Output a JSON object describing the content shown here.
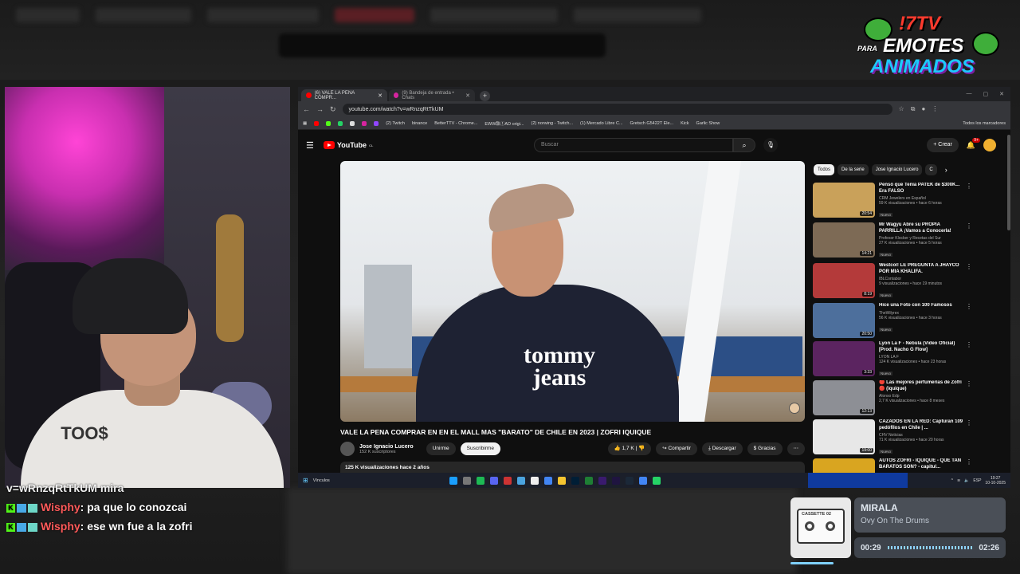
{
  "browser": {
    "tabs": [
      {
        "label": "(6) VALE LA PENA COMPR...",
        "active": true
      },
      {
        "label": "(9) Bandeja de entrada • Chats",
        "active": false
      }
    ],
    "url": "youtube.com/watch?v=wRnzqRtTkUM",
    "bookmarks": [
      "(2) Twitch",
      "binance",
      "BetterTTV - Chrome...",
      "EWW執①AD origi...",
      "(2) norwing - Twitch...",
      "(1) Mercado Libre C...",
      "Gretsch G5422T Ele...",
      "Kick",
      "Garlic Show"
    ],
    "all_bookmarks": "Todos los marcadores"
  },
  "youtube": {
    "logo": "YouTube",
    "logo_sup": "CL",
    "search_placeholder": "Buscar",
    "create_label": "Crear",
    "notif_count": "9+",
    "video": {
      "title": "VALE LA PENA COMPRAR EN EN EL MALL MAS \"BARATO\" DE CHILE EN 2023 | ZOFRI IQUIQUE",
      "channel": "Jose Ignacio Lucero",
      "subs": "152 K suscriptores",
      "join": "Unirme",
      "subscribe": "Suscribirme",
      "likes": "1,7 K",
      "share": "Compartir",
      "download": "Descargar",
      "thanks": "Gracias",
      "more": "⋯",
      "views_date": "125 K visualizaciones  hace 2 años"
    },
    "chips": [
      "Todos",
      "De la serie",
      "Jose Ignacio Lucero",
      "C"
    ],
    "recommendations": [
      {
        "title": "Pensó que Tenía PATEK de $300K... Era FALSO",
        "channel": "CRM Jewelers en Español",
        "meta": "59 K visualizaciones • hace 6 horas",
        "duration": "20:54",
        "badge": "Nuevo",
        "color": "#c9a15a"
      },
      {
        "title": "Mr Wagyu Abre su PROPIA PARRILLA ¡Vamos a Conocerla!",
        "channel": "Profesor Klocker y Recetas del Sur",
        "meta": "27 K visualizaciones • hace 5 horas",
        "duration": "14:21",
        "badge": "Nuevo",
        "color": "#7d6a55"
      },
      {
        "title": "Westcol! LE PREGUNTA A JHAYCO POR MIA KHALIFA.",
        "channel": "IBLContabor",
        "meta": "9 visualizaciones • hace 19 minutos",
        "duration": "8:19",
        "badge": "Nuevo",
        "color": "#b43a3a"
      },
      {
        "title": "Hice una Foto con 100 Famosos",
        "channel": "TheWilyrex",
        "meta": "56 K visualizaciones • hace 3 horas",
        "duration": "20:50",
        "badge": "Nuevo",
        "color": "#4d6f9c"
      },
      {
        "title": "Lyon La F - Nebula (Video Oficial) [Prod. Nacho G Flow]",
        "channel": "LYON LA F",
        "meta": "124 K visualizaciones • hace 23 horas",
        "duration": "3:33",
        "badge": "Nuevo",
        "color": "#5b2460"
      },
      {
        "title": "🔴 Las mejores perfumerías de Zofri 🔴 (iquique)",
        "channel": "Alonso Edp",
        "meta": "2,7 K visualizaciones • hace 8 meses",
        "duration": "12:13",
        "badge": "",
        "color": "#8d8f95"
      },
      {
        "title": "CAZADOS EN LA RED: Capturan 109 pedófilos en Chile | ...",
        "channel": "CHV Noticias",
        "meta": "71 K visualizaciones • hace 20 horas",
        "duration": "19:00",
        "badge": "Nuevo",
        "color": "#e7e7e7"
      },
      {
        "title": "AUTOS ZOFRI - IQUIQUE - QUE TAN BARATOS SON? - capitul...",
        "channel": "",
        "meta": "",
        "duration": "",
        "badge": "",
        "color": "#d9a520"
      }
    ]
  },
  "video_overlay_text": "tommy\njeans",
  "taskbar": {
    "label": "Vínculos",
    "lang": "ESP",
    "time": "19:27",
    "date": "10-10-2025"
  },
  "chat": [
    {
      "text": "v=wRnzqRtTkUM mira",
      "user": "",
      "badges": false
    },
    {
      "user": "Wisphy",
      "text": ": pa que lo conozcai",
      "badges": true
    },
    {
      "user": "Wisphy",
      "text": ": ese wn fue a la zofri",
      "badges": true
    }
  ],
  "now_playing": {
    "title": "MIRALA",
    "artist": "Ovy On The Drums",
    "elapsed": "00:29",
    "total": "02:26",
    "progress": 0.2,
    "cover_label": "CASSETTE 02"
  },
  "promo": {
    "top": "!7TV",
    "para": "PARA",
    "emotes": "EMOTES",
    "animados": "ANIMADOS"
  },
  "webcam_shirt_text": "TOO$"
}
